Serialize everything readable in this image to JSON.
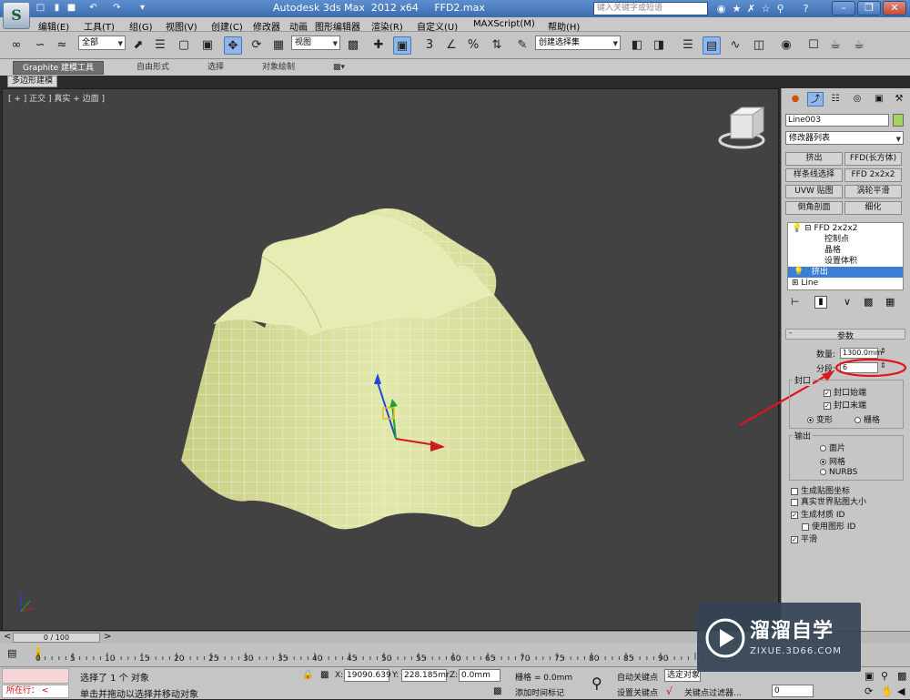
{
  "titlebar": {
    "title": "Autodesk 3ds Max  2012 x64",
    "filename": "FFD2.max",
    "search_placeholder": "键入关键字或短语",
    "app_logo": "3ds-max-logo",
    "accent": "#4a7bc0"
  },
  "menus": [
    "编辑(E)",
    "工具(T)",
    "组(G)",
    "视图(V)",
    "创建(C)",
    "修改器",
    "动画",
    "图形编辑器",
    "渲染(R)",
    "自定义(U)",
    "MAXScript(M)",
    "帮助(H)"
  ],
  "toolbar": {
    "filter_value": "全部",
    "refcoord_value": "视图",
    "selset_value": "创建选择集"
  },
  "ribbon": {
    "tabs": [
      "Graphite 建模工具",
      "自由形式",
      "选择",
      "对象绘制"
    ],
    "subtab": "多边形建模"
  },
  "viewport": {
    "label": "[ + ] 正交 ] 真实 + 边面 ]",
    "mesh_color": "#e7ebb4"
  },
  "panel": {
    "object_name": "Line003",
    "object_color": "#a4d65e",
    "modifier_list": "修改器列表",
    "buttons": [
      "挤出",
      "FFD(长方体)",
      "样条线选择",
      "FFD 2x2x2",
      "UVW 贴图",
      "涡轮平滑",
      "倒角剖面",
      "细化"
    ],
    "stack": [
      "FFD 2x2x2",
      "控制点",
      "晶格",
      "设置体积",
      "挤出",
      "Line"
    ],
    "rollout_title": "参数",
    "amount_label": "数量:",
    "amount_value": "1300.0mm",
    "segments_label": "分段:",
    "segments_value": "6",
    "capping_label": "封口",
    "cap_start": "封口始端",
    "cap_end": "封口末端",
    "morph": "变形",
    "grid": "栅格",
    "output_label": "输出",
    "patch": "面片",
    "mesh": "网格",
    "nurbs": "NURBS",
    "gen_map": "生成贴图坐标",
    "real_world": "真实世界贴图大小",
    "gen_mat": "生成材质 ID",
    "use_shape": "使用图形 ID",
    "smooth": "平滑"
  },
  "timeline": {
    "frame": "0 / 100",
    "ticks": [
      "0",
      "5",
      "10",
      "15",
      "20",
      "25",
      "30",
      "35",
      "40",
      "45",
      "50",
      "55",
      "60",
      "65",
      "70",
      "75",
      "80",
      "85",
      "90"
    ]
  },
  "status": {
    "selected": "选择了 1 个 对象",
    "hint": "单击并拖动以选择并移动对象",
    "mini_listener": "所在行：",
    "x_label": "X:",
    "x_value": "19090.639",
    "y_label": "Y:",
    "y_value": "228.185mr",
    "z_label": "Z:",
    "z_value": "0.0mm",
    "grid": "栅格 = 0.0mm",
    "add_time_tag": "添加时间标记",
    "auto_key": "自动关键点",
    "set_key": "设置关键点",
    "selected_obj": "选定对象",
    "key_filter": "关键点过滤器...",
    "frame_field": "0"
  },
  "watermark": {
    "title": "溜溜自学",
    "url": "ZIXUE.3D66.COM"
  }
}
